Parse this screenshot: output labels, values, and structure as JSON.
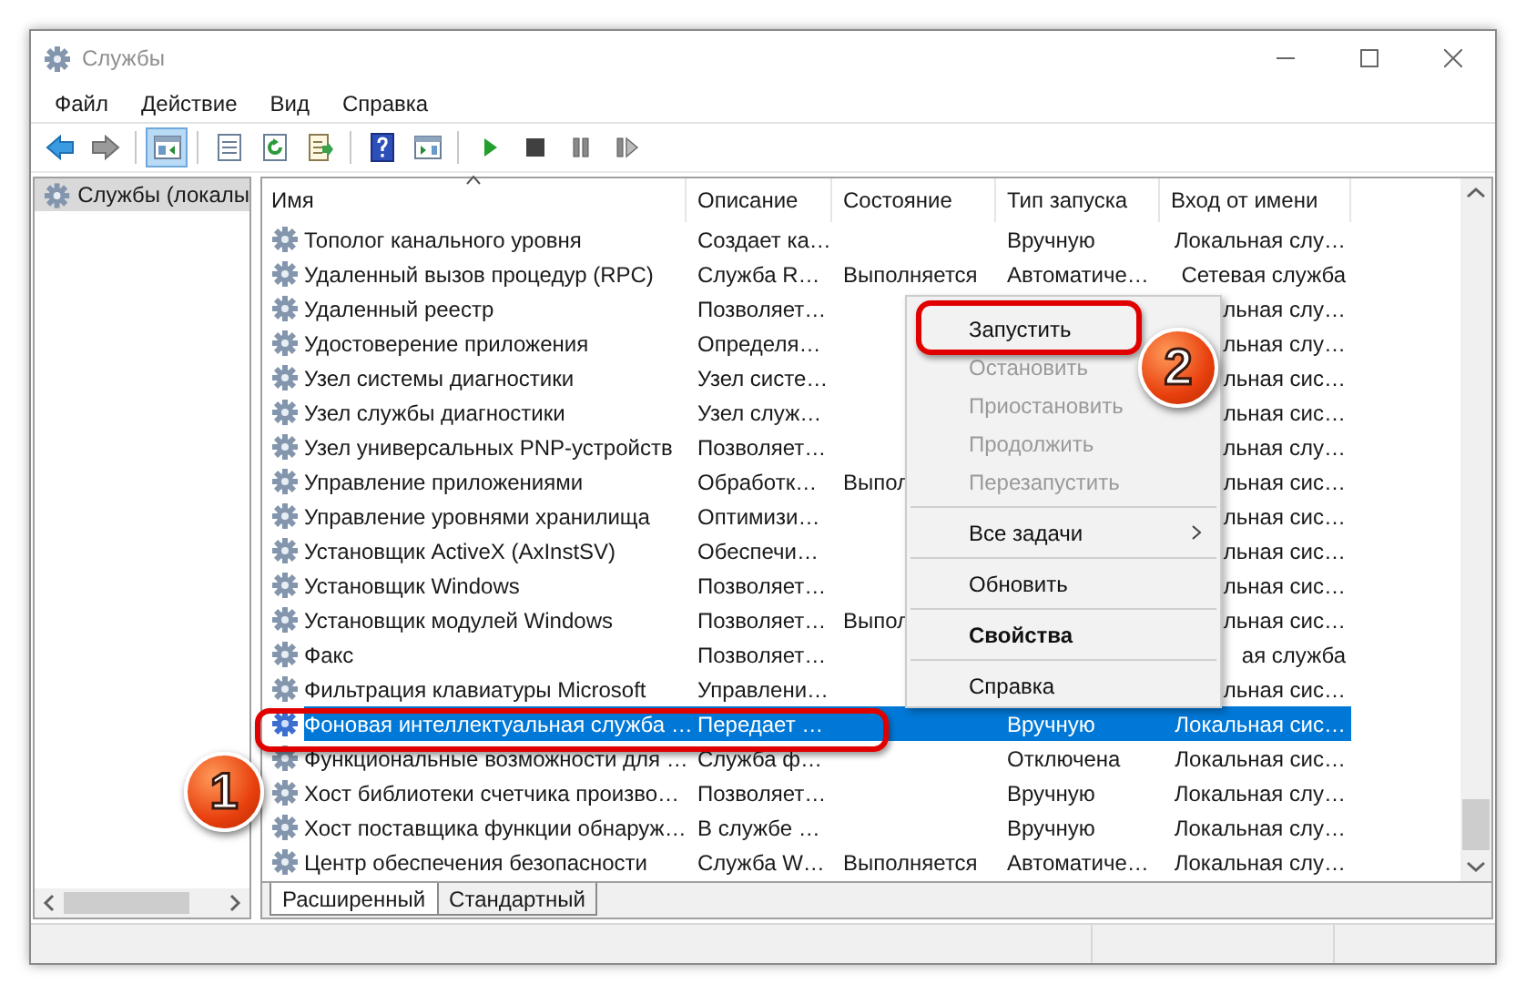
{
  "window": {
    "title": "Службы"
  },
  "menu": [
    "Файл",
    "Действие",
    "Вид",
    "Справка"
  ],
  "toolbar": [
    [
      {
        "kind": "back",
        "pressed": false
      },
      {
        "kind": "forward",
        "pressed": false
      }
    ],
    [
      {
        "kind": "tree",
        "pressed": true
      }
    ],
    [
      {
        "kind": "properties",
        "pressed": false
      },
      {
        "kind": "refresh",
        "pressed": false
      },
      {
        "kind": "export",
        "pressed": false
      }
    ],
    [
      {
        "kind": "help",
        "pressed": false
      },
      {
        "kind": "pane",
        "pressed": false
      }
    ],
    [
      {
        "kind": "play",
        "pressed": false
      },
      {
        "kind": "stop",
        "pressed": false
      },
      {
        "kind": "pause",
        "pressed": false
      },
      {
        "kind": "resume",
        "pressed": false
      }
    ]
  ],
  "tree": {
    "items": [
      {
        "label": "Службы (локалы",
        "selected": true
      }
    ]
  },
  "table": {
    "columns": [
      {
        "label": "Имя",
        "sorted": true
      },
      {
        "label": "Описание",
        "sorted": false
      },
      {
        "label": "Состояние",
        "sorted": false
      },
      {
        "label": "Тип запуска",
        "sorted": false
      },
      {
        "label": "Вход от имени",
        "sorted": false
      }
    ],
    "rows": [
      {
        "name": "Тополог канального уровня",
        "description": "Создает ка…",
        "startup": "Вручную",
        "logon": "Локальная слу…",
        "selected": false
      },
      {
        "name": "Удаленный вызов процедур (RPC)",
        "description": "Служба R…",
        "status": "Выполняется",
        "startup": "Автоматиче…",
        "logon": "Сетевая служба",
        "selected": false
      },
      {
        "name": "Удаленный реестр",
        "description": "Позволяет…",
        "logon": "льная слу…",
        "selected": false
      },
      {
        "name": "Удостоверение приложения",
        "description": "Определя…",
        "logon": "льная слу…",
        "selected": false
      },
      {
        "name": "Узел системы диагностики",
        "description": "Узел систе…",
        "logon": "льная сис…",
        "selected": false
      },
      {
        "name": "Узел службы диагностики",
        "description": "Узел служ…",
        "logon": "льная сис…",
        "selected": false
      },
      {
        "name": "Узел универсальных PNP-устройств",
        "description": "Позволяет…",
        "logon": "льная слу…",
        "selected": false
      },
      {
        "name": "Управление приложениями",
        "description": "Обработк…",
        "status": "Выпол",
        "logon": "льная сис…",
        "selected": false
      },
      {
        "name": "Управление уровнями хранилища",
        "description": "Оптимизи…",
        "logon": "льная сис…",
        "selected": false
      },
      {
        "name": "Установщик ActiveX (AxInstSV)",
        "description": "Обеспечи…",
        "logon": "льная сис…",
        "selected": false
      },
      {
        "name": "Установщик Windows",
        "description": "Позволяет…",
        "logon": "льная сис…",
        "selected": false
      },
      {
        "name": "Установщик модулей Windows",
        "description": "Позволяет…",
        "status": "Выпол",
        "logon": "льная сис…",
        "selected": false
      },
      {
        "name": "Факс",
        "description": "Позволяет…",
        "logon": "ая служба",
        "selected": false
      },
      {
        "name": "Фильтрация клавиатуры Microsoft",
        "description": "Управлени…",
        "logon": "льная сис…",
        "selected": false
      },
      {
        "name": "Фоновая интеллектуальная служба …",
        "description": "Передает …",
        "startup": "Вручную",
        "logon": "Локальная сис…",
        "selected": true
      },
      {
        "name": "Функциональные возможности для …",
        "description": "Служба ф…",
        "startup": "Отключена",
        "logon": "Локальная сис…",
        "selected": false
      },
      {
        "name": "Хост библиотеки счетчика произво…",
        "description": "Позволяет…",
        "startup": "Вручную",
        "logon": "Локальная слу…",
        "selected": false
      },
      {
        "name": "Хост поставщика функции обнаруж…",
        "description": "В службе …",
        "startup": "Вручную",
        "logon": "Локальная слу…",
        "selected": false
      },
      {
        "name": "Центр обеспечения безопасности",
        "description": "Служба W…",
        "status": "Выполняется",
        "startup": "Автоматиче…",
        "logon": "Локальная слу…",
        "selected": false
      }
    ]
  },
  "tabs": [
    {
      "label": "Расширенный",
      "selected": true
    },
    {
      "label": "Стандартный",
      "selected": false
    }
  ],
  "context_menu": [
    {
      "kind": "item",
      "label": "Запустить",
      "disabled": false,
      "default": false
    },
    {
      "kind": "item",
      "label": "Остановить",
      "disabled": true,
      "default": false
    },
    {
      "kind": "item",
      "label": "Приостановить",
      "disabled": true,
      "default": false
    },
    {
      "kind": "item",
      "label": "Продолжить",
      "disabled": true,
      "default": false
    },
    {
      "kind": "item",
      "label": "Перезапустить",
      "disabled": true,
      "default": false
    },
    {
      "kind": "separator"
    },
    {
      "kind": "submenu",
      "label": "Все задачи",
      "disabled": false,
      "default": false
    },
    {
      "kind": "separator"
    },
    {
      "kind": "item",
      "label": "Обновить",
      "disabled": false,
      "default": false
    },
    {
      "kind": "separator"
    },
    {
      "kind": "item",
      "label": "Свойства",
      "disabled": false,
      "default": true
    },
    {
      "kind": "separator"
    },
    {
      "kind": "item",
      "label": "Справка",
      "disabled": false,
      "default": false
    }
  ],
  "callouts": [
    {
      "number": "1"
    },
    {
      "number": "2"
    }
  ]
}
